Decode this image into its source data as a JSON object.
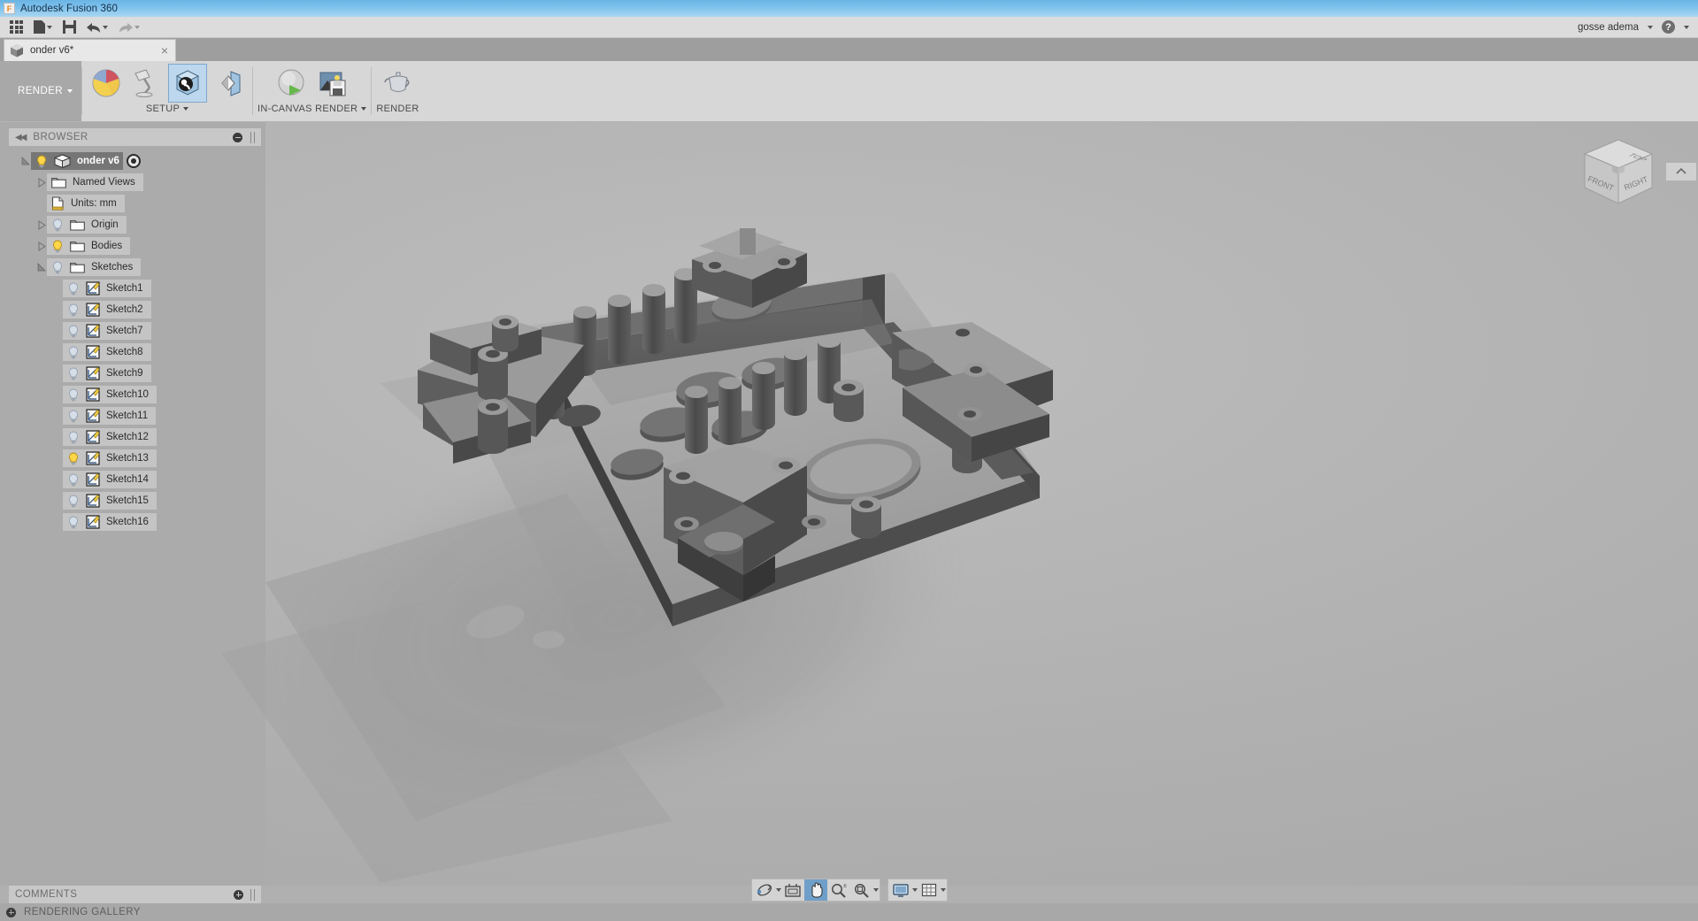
{
  "window": {
    "title": "Autodesk Fusion 360",
    "app_icon": "fusion-logo-icon"
  },
  "appbar": {
    "buttons": [
      {
        "name": "show-data-panel",
        "icon": "grid-9-icon",
        "label": ""
      },
      {
        "name": "new-document",
        "icon": "file-icon",
        "label": "",
        "has_caret": true
      },
      {
        "name": "save",
        "icon": "floppy-disk-icon",
        "label": ""
      },
      {
        "name": "undo",
        "icon": "undo-arrow-icon",
        "label": "",
        "has_caret": true
      },
      {
        "name": "redo",
        "icon": "redo-arrow-icon",
        "label": "",
        "has_caret": true
      }
    ],
    "user": "gosse adema",
    "help_label": "?"
  },
  "tabs": [
    {
      "label": "onder v6*",
      "icon": "cube-icon",
      "close": "×",
      "active": true
    }
  ],
  "ribbon": {
    "workspace": "RENDER",
    "panels": [
      {
        "label": "SETUP",
        "has_caret": true,
        "buttons": [
          {
            "name": "appearance-button",
            "icon": "appearance-sphere-icon",
            "tip": "Appearance"
          },
          {
            "name": "scene-settings-button",
            "icon": "desk-lamp-icon",
            "tip": "Scene Settings"
          },
          {
            "name": "texture-map-controls-button",
            "icon": "texture-cube-icon",
            "tip": "Texture Map Controls"
          },
          {
            "name": "decal-button",
            "icon": "decal-icon",
            "tip": "Decal"
          }
        ]
      },
      {
        "label": "IN-CANVAS RENDER",
        "has_caret": true,
        "buttons": [
          {
            "name": "in-canvas-render-button",
            "icon": "render-play-icon",
            "tip": "In-Canvas Render"
          },
          {
            "name": "capture-image-button",
            "icon": "capture-image-icon",
            "tip": "Capture Image"
          }
        ]
      },
      {
        "label": "RENDER",
        "has_caret": false,
        "buttons": [
          {
            "name": "render-button",
            "icon": "teapot-icon",
            "tip": "Render"
          }
        ]
      }
    ]
  },
  "browser": {
    "header": "BROWSER",
    "collapse_icon": "collapse-left-icon",
    "minimize_icon": "minus-circle-icon",
    "tree": [
      {
        "name": "onder v6",
        "label": "onder v6",
        "indent": 0,
        "expander": "expanded",
        "bulb": "on",
        "icon": "component-cube-icon",
        "root": true,
        "trailing": "target-dot-icon"
      },
      {
        "name": "named-views",
        "label": "Named Views",
        "indent": 1,
        "expander": "collapsed",
        "bulb": "none",
        "icon": "folder-icon"
      },
      {
        "name": "units",
        "label": "Units: mm",
        "indent": 1,
        "expander": "none",
        "bulb": "none",
        "icon": "units-doc-icon"
      },
      {
        "name": "origin",
        "label": "Origin",
        "indent": 1,
        "expander": "collapsed",
        "bulb": "off",
        "icon": "folder-icon"
      },
      {
        "name": "bodies",
        "label": "Bodies",
        "indent": 1,
        "expander": "collapsed",
        "bulb": "on",
        "icon": "folder-icon"
      },
      {
        "name": "sketches",
        "label": "Sketches",
        "indent": 1,
        "expander": "expanded",
        "bulb": "off",
        "icon": "folder-icon"
      },
      {
        "name": "sketch1",
        "label": "Sketch1",
        "indent": 2,
        "expander": "none",
        "bulb": "off",
        "icon": "sketch-icon"
      },
      {
        "name": "sketch2",
        "label": "Sketch2",
        "indent": 2,
        "expander": "none",
        "bulb": "off",
        "icon": "sketch-icon"
      },
      {
        "name": "sketch7",
        "label": "Sketch7",
        "indent": 2,
        "expander": "none",
        "bulb": "off",
        "icon": "sketch-icon"
      },
      {
        "name": "sketch8",
        "label": "Sketch8",
        "indent": 2,
        "expander": "none",
        "bulb": "off",
        "icon": "sketch-icon"
      },
      {
        "name": "sketch9",
        "label": "Sketch9",
        "indent": 2,
        "expander": "none",
        "bulb": "off",
        "icon": "sketch-icon"
      },
      {
        "name": "sketch10",
        "label": "Sketch10",
        "indent": 2,
        "expander": "none",
        "bulb": "off",
        "icon": "sketch-icon"
      },
      {
        "name": "sketch11",
        "label": "Sketch11",
        "indent": 2,
        "expander": "none",
        "bulb": "off",
        "icon": "sketch-icon"
      },
      {
        "name": "sketch12",
        "label": "Sketch12",
        "indent": 2,
        "expander": "none",
        "bulb": "off",
        "icon": "sketch-icon"
      },
      {
        "name": "sketch13",
        "label": "Sketch13",
        "indent": 2,
        "expander": "none",
        "bulb": "on",
        "icon": "sketch-icon"
      },
      {
        "name": "sketch14",
        "label": "Sketch14",
        "indent": 2,
        "expander": "none",
        "bulb": "off",
        "icon": "sketch-icon"
      },
      {
        "name": "sketch15",
        "label": "Sketch15",
        "indent": 2,
        "expander": "none",
        "bulb": "off",
        "icon": "sketch-icon"
      },
      {
        "name": "sketch16",
        "label": "Sketch16",
        "indent": 2,
        "expander": "none",
        "bulb": "off",
        "icon": "sketch-icon"
      }
    ]
  },
  "viewcube": {
    "faces": {
      "top": "TOP",
      "front": "FRONT",
      "right": "RIGHT"
    }
  },
  "navbar": {
    "groups": [
      [
        {
          "name": "orbit-button",
          "icon": "orbit-icon",
          "has_caret": true,
          "selected": false
        },
        {
          "name": "pan-look-at-button",
          "icon": "look-at-icon",
          "has_caret": false,
          "selected": false
        },
        {
          "name": "pan-button",
          "icon": "hand-pan-icon",
          "has_caret": false,
          "selected": true
        },
        {
          "name": "zoom-button",
          "icon": "zoom-magnifier-icon",
          "has_caret": false,
          "selected": false
        },
        {
          "name": "zoom-fit-button",
          "icon": "zoom-fit-icon",
          "has_caret": true,
          "selected": false
        }
      ],
      [
        {
          "name": "display-settings-button",
          "icon": "monitor-icon",
          "has_caret": true,
          "selected": false
        },
        {
          "name": "grid-snaps-button",
          "icon": "grid-icon",
          "has_caret": true,
          "selected": false
        }
      ]
    ]
  },
  "comments": {
    "title": "COMMENTS",
    "add_icon": "plus-circle-icon"
  },
  "statusbar": {
    "title": "RENDERING GALLERY",
    "add_icon": "plus-circle-icon"
  },
  "colors": {
    "title_bar": "#7cc0ec",
    "ribbon_bg": "#d7d7d7",
    "panel_bg": "#ababab",
    "canvas_bg": "#b2b2b2",
    "accent_selected": "#6f9fc8",
    "tree_row": "#c4c4c4",
    "root_row": "#767676",
    "bulb_on": "#ffd64a",
    "bulb_off": "#cfd8e4",
    "model_light": "#a9a9a9",
    "model_dark": "#4c4c4c"
  }
}
